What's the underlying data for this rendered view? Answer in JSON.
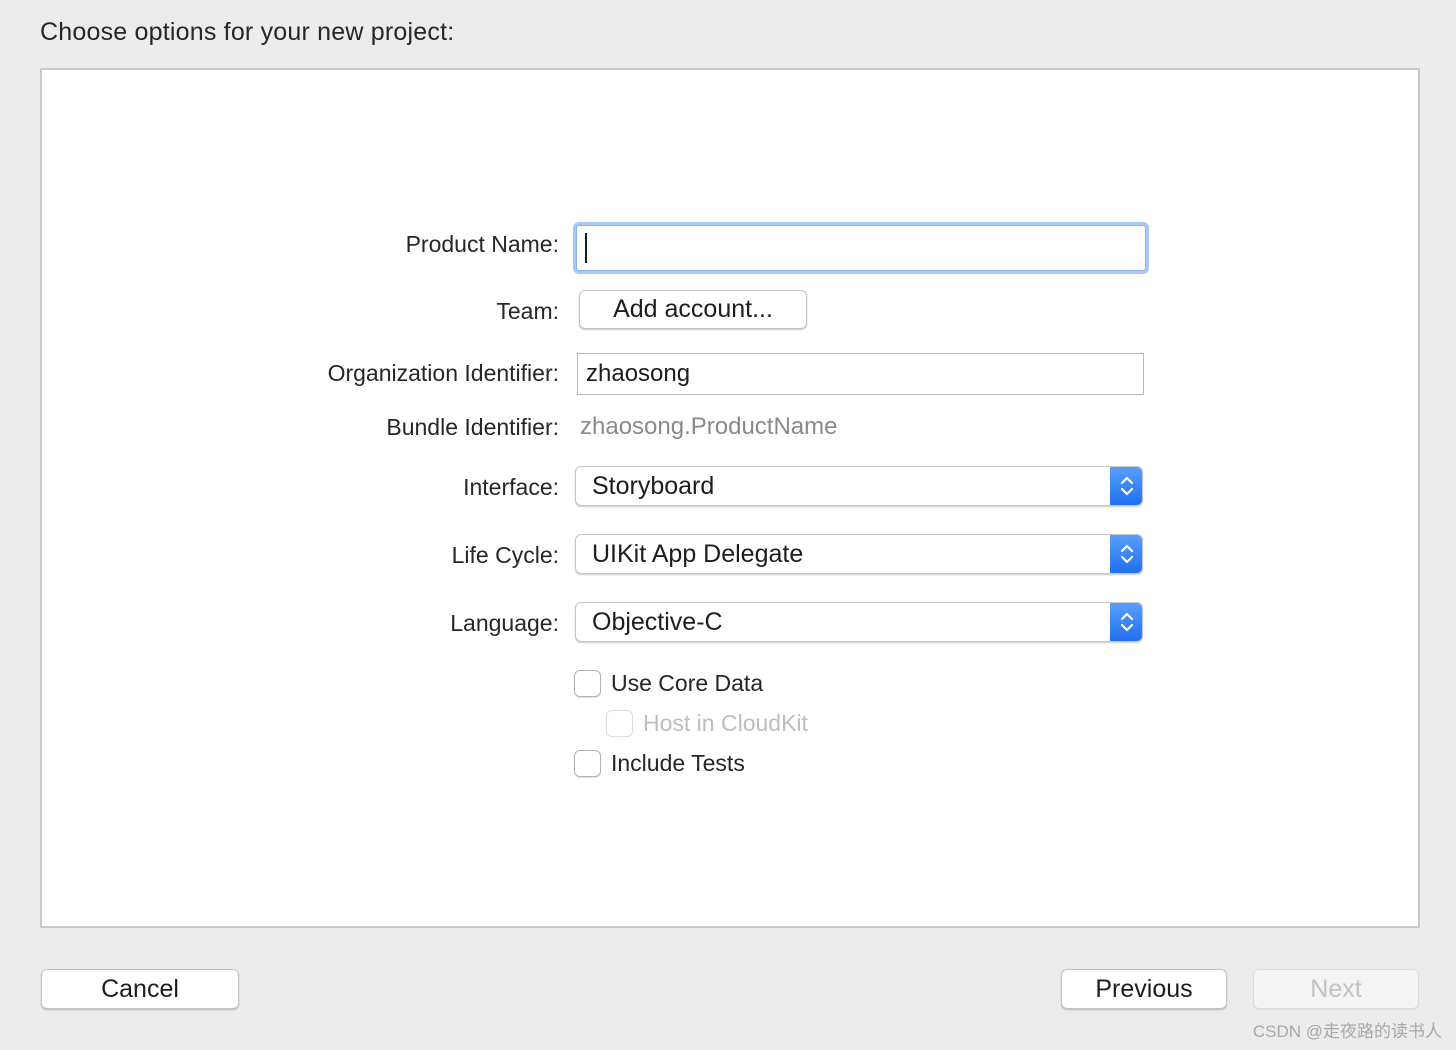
{
  "dialog": {
    "heading": "Choose options for your new project:"
  },
  "form": {
    "product_name": {
      "label": "Product Name:",
      "value": ""
    },
    "team": {
      "label": "Team:",
      "button_label": "Add account..."
    },
    "organization_identifier": {
      "label": "Organization Identifier:",
      "value": "zhaosong"
    },
    "bundle_identifier": {
      "label": "Bundle Identifier:",
      "value": "zhaosong.ProductName"
    },
    "interface": {
      "label": "Interface:",
      "selected": "Storyboard"
    },
    "life_cycle": {
      "label": "Life Cycle:",
      "selected": "UIKit App Delegate"
    },
    "language": {
      "label": "Language:",
      "selected": "Objective-C"
    },
    "options": {
      "use_core_data": {
        "label": "Use Core Data",
        "checked": false
      },
      "host_in_cloudkit": {
        "label": "Host in CloudKit",
        "checked": false,
        "enabled": false
      },
      "include_tests": {
        "label": "Include Tests",
        "checked": false
      }
    }
  },
  "footer": {
    "cancel_label": "Cancel",
    "previous_label": "Previous",
    "next_label": "Next"
  },
  "watermark": "CSDN @走夜路的读书人",
  "colors": {
    "accent": "#1e6fef",
    "focus_ring": "#a9c8f6",
    "window_bg": "#ececec"
  },
  "icons": {
    "popup_stepper": "chevron-up-down-icon"
  }
}
